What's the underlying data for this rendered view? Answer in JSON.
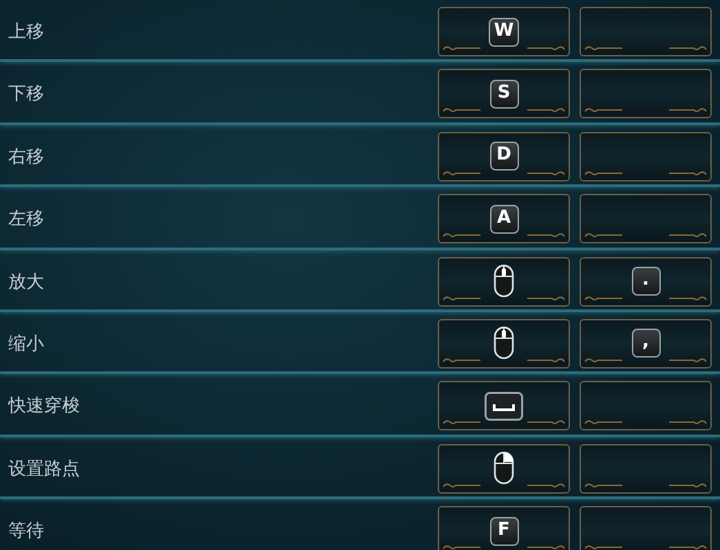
{
  "bindings": [
    {
      "action": "上移",
      "primary": {
        "kind": "key",
        "label": "W"
      },
      "secondary": {
        "kind": "empty"
      }
    },
    {
      "action": "下移",
      "primary": {
        "kind": "key",
        "label": "S"
      },
      "secondary": {
        "kind": "empty"
      }
    },
    {
      "action": "右移",
      "primary": {
        "kind": "key",
        "label": "D"
      },
      "secondary": {
        "kind": "empty"
      }
    },
    {
      "action": "左移",
      "primary": {
        "kind": "key",
        "label": "A"
      },
      "secondary": {
        "kind": "empty"
      }
    },
    {
      "action": "放大",
      "primary": {
        "kind": "mouse-wheel"
      },
      "secondary": {
        "kind": "key",
        "label": "."
      }
    },
    {
      "action": "缩小",
      "primary": {
        "kind": "mouse-wheel"
      },
      "secondary": {
        "kind": "key",
        "label": ","
      }
    },
    {
      "action": "快速穿梭",
      "primary": {
        "kind": "spacebar"
      },
      "secondary": {
        "kind": "empty"
      }
    },
    {
      "action": "设置路点",
      "primary": {
        "kind": "mouse-right"
      },
      "secondary": {
        "kind": "empty"
      }
    },
    {
      "action": "等待",
      "primary": {
        "kind": "key",
        "label": "F"
      },
      "secondary": {
        "kind": "empty"
      }
    }
  ]
}
